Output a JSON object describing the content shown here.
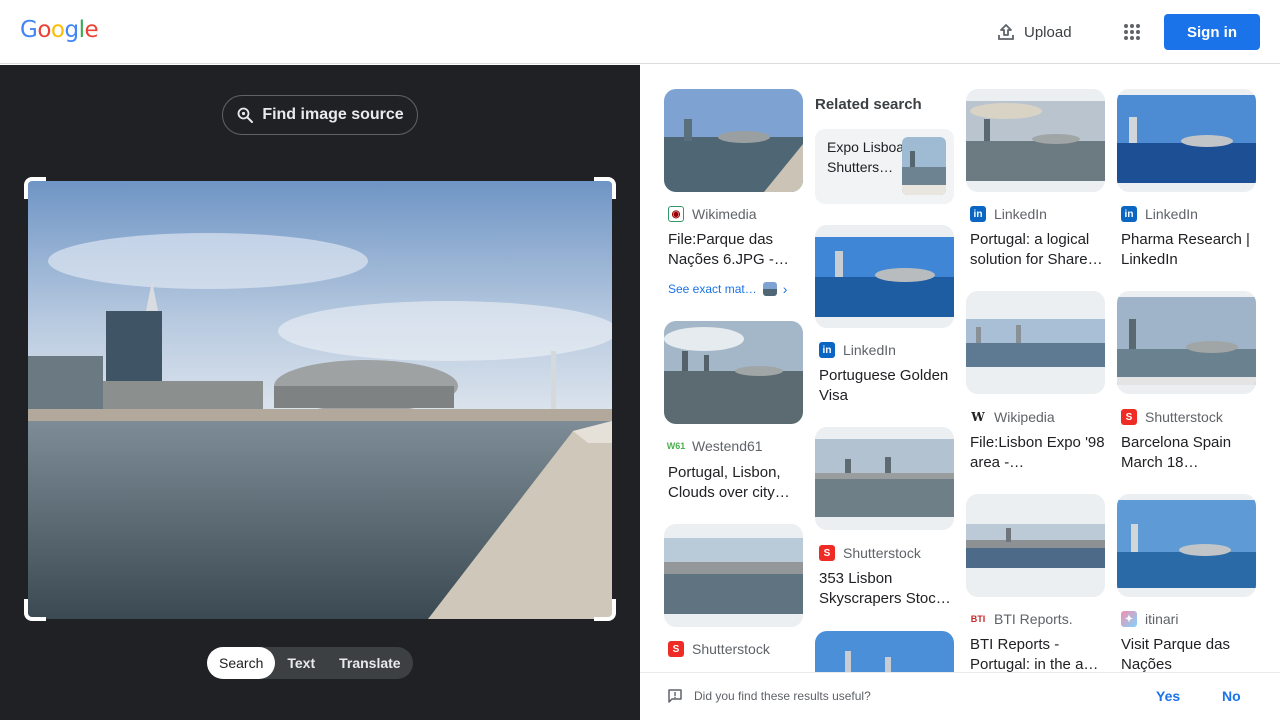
{
  "header": {
    "logo": [
      "G",
      "o",
      "o",
      "g",
      "l",
      "e"
    ],
    "logo_colors": [
      "#4285F4",
      "#EA4335",
      "#FBBC05",
      "#4285F4",
      "#34A853",
      "#EA4335"
    ],
    "upload_label": "Upload",
    "signin_label": "Sign in"
  },
  "left": {
    "find_source_label": "Find image source",
    "tabs": [
      "Search",
      "Text",
      "Translate"
    ],
    "active_tab": "Search"
  },
  "results": {
    "related_title": "Related search",
    "related_chip": "Expo Lisboa Shutters…",
    "exact_match": "See exact mat…",
    "cards": [
      {
        "source": "Wikimedia",
        "title": "File:Parque das Nações 6.JPG -…"
      },
      {
        "source": "Westend61",
        "title": "Portugal, Lisbon, Clouds over city…"
      },
      {
        "source": "Shutterstock",
        "title": ""
      },
      {
        "source": "LinkedIn",
        "title": "Portuguese Golden Visa"
      },
      {
        "source": "Shutterstock",
        "title": "353 Lisbon Skyscrapers Stoc…"
      },
      {
        "source": "LinkedIn",
        "title": "Portugal: a logical solution for Share…"
      },
      {
        "source": "Wikipedia",
        "title": "File:Lisbon Expo '98 area -…"
      },
      {
        "source": "BTI Reports.",
        "title": "BTI Reports - Portugal: in the a…"
      },
      {
        "source": "LinkedIn",
        "title": "Pharma Research | LinkedIn"
      },
      {
        "source": "Shutterstock",
        "title": "Barcelona Spain March 18…"
      },
      {
        "source": "itinari",
        "title": "Visit Parque das Nações"
      }
    ]
  },
  "feedback": {
    "question": "Did you find these results useful?",
    "yes": "Yes",
    "no": "No"
  },
  "colors": {
    "accent": "#1a73e8",
    "dark_panel": "#202124"
  }
}
